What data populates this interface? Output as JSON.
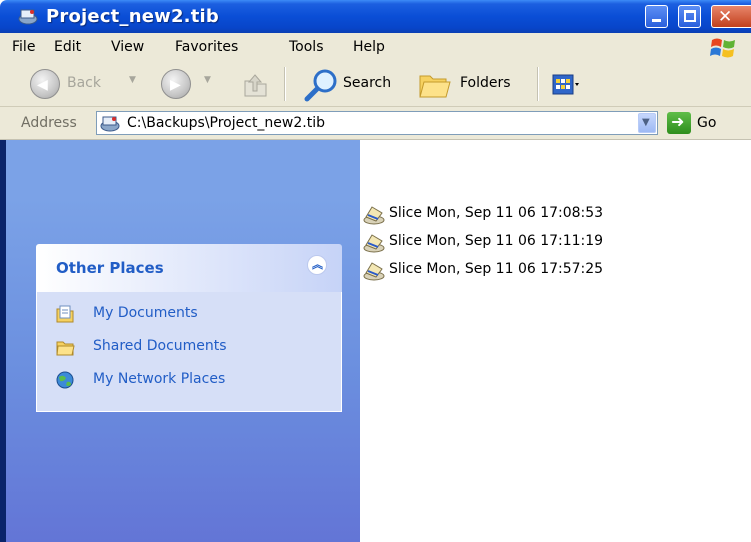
{
  "window": {
    "title": "Project_new2.tib",
    "icon": "tib-archive-icon",
    "controls": [
      "minimize",
      "maximize",
      "close"
    ]
  },
  "menu": {
    "items": [
      "File",
      "Edit",
      "View",
      "Favorites",
      "Tools",
      "Help"
    ]
  },
  "toolbar": {
    "back_label": "Back",
    "search_label": "Search",
    "folders_label": "Folders"
  },
  "address": {
    "label": "Address",
    "value": "C:\\Backups\\Project_new2.tib",
    "go_label": "Go"
  },
  "left_panel": {
    "title": "Other Places",
    "items": [
      {
        "label": "My Documents",
        "icon": "my-documents-icon"
      },
      {
        "label": "Shared Documents",
        "icon": "shared-documents-icon"
      },
      {
        "label": "My Network Places",
        "icon": "network-places-icon"
      }
    ]
  },
  "files": [
    {
      "label": "Slice Mon, Sep 11 06 17:08:53",
      "icon": "slice-icon"
    },
    {
      "label": "Slice Mon, Sep 11 06 17:11:19",
      "icon": "slice-icon"
    },
    {
      "label": "Slice Mon, Sep 11 06 17:57:25",
      "icon": "slice-icon"
    }
  ],
  "colors": {
    "titlebar": "#0a4ed6",
    "chrome": "#ece9d8",
    "task_pane": "#7ba2e7",
    "link": "#215dc6"
  }
}
